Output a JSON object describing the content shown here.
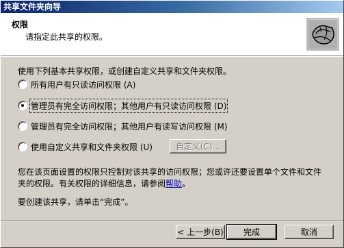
{
  "window": {
    "title": "共享文件夹向导"
  },
  "header": {
    "title": "权限",
    "subtitle": "请指定此共享的权限。",
    "icon": "shared-folder-wizard-icon"
  },
  "main": {
    "instruction": "使用下列基本共享权限，或创建自定义共享和文件夹权限。",
    "options": [
      {
        "label": "所有用户有只读访问权限 (A)",
        "checked": false
      },
      {
        "label": "管理员有完全访问权限；其他用户有只读访问权限 (D)",
        "checked": true
      },
      {
        "label": "管理员有完全访问权限；其他用户有读写访问权限 (M)",
        "checked": false
      },
      {
        "label": "使用自定义共享和文件夹权限 (U)",
        "checked": false
      }
    ],
    "custom_button": "自定义(C)...",
    "note_line1": "您在该页面设置的权限只控制对该共享的访问权限；您或许还要设置单个文件和文件",
    "note_line2_prefix": "夹的权限。有关权限的详细信息，请参阅",
    "note_link": "帮助",
    "note_line2_suffix": "。",
    "finish_hint": "要创建该共享，请单击“完成”。"
  },
  "footer": {
    "back": "< 上一步(B)",
    "finish": "完成",
    "cancel": "取消"
  }
}
